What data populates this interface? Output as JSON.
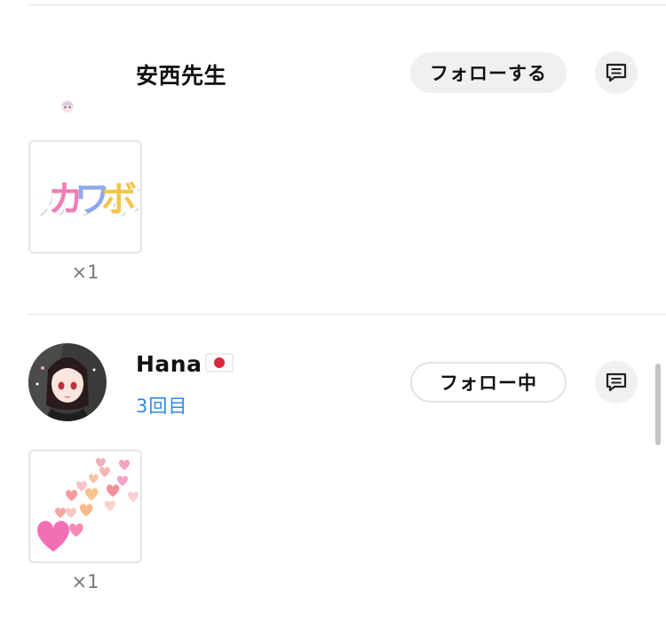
{
  "entries": [
    {
      "username": "安西先生",
      "visit_count": "",
      "follow_label": "フォローする",
      "gift_text": "カワボ",
      "gift_count": "×1"
    },
    {
      "username": "Hana",
      "flag_icon": "japan-flag-icon",
      "visit_count": "3回目",
      "follow_label": "フォロー中",
      "gift_name": "hearts",
      "gift_count": "×1"
    }
  ],
  "icons": {
    "message": "chat-bubble-icon"
  },
  "colors": {
    "accent_blue": "#2d8ae6",
    "button_gray": "#f0f0f0",
    "border_gray": "#e3e3e3"
  }
}
